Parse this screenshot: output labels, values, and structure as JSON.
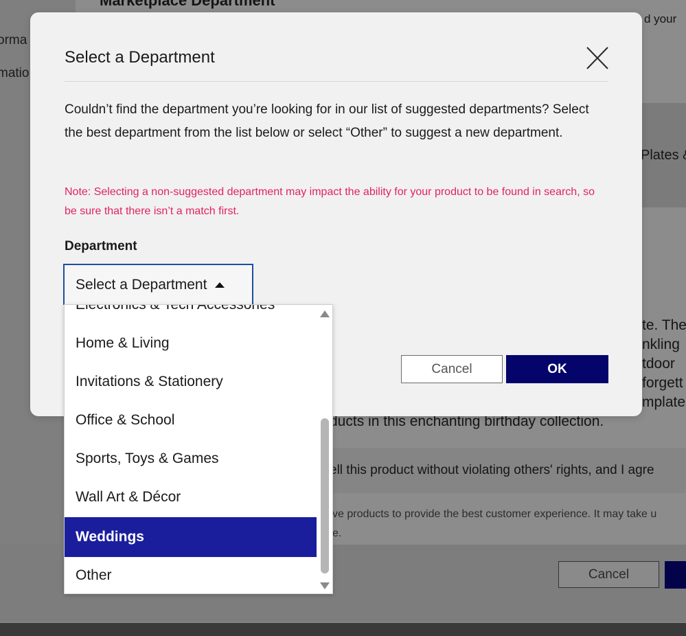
{
  "background": {
    "top_heading": "Marketplace Department",
    "top_right_text": "d your",
    "sidebar_items": [
      "orma",
      "matio"
    ],
    "band_right_text": "Plates &",
    "desc_fragments": [
      "te. The",
      "nkling",
      "tdoor",
      "forgett",
      "mplate"
    ],
    "desc_last_line": "ducts in this enchanting birthday collection.",
    "rights_line": "ell this product without violating others' rights, and I agre",
    "review_line_1": "ve products to provide the best customer experience. It may take u",
    "review_line_2": "e.",
    "cancel_label": "Cancel"
  },
  "modal": {
    "title": "Select a Department",
    "description": "Couldn’t find the department you’re looking for in our list of suggested departments? Select the best department from the list below or select “Other” to suggest a new department.",
    "note": "Note: Selecting a non-suggested department may impact the ability for your product to be found in search, so be sure that there isn’t a match first.",
    "field_label": "Department",
    "select_value": "Select a Department",
    "cancel_label": "Cancel",
    "ok_label": "OK"
  },
  "dropdown": {
    "options": [
      "Electronics & Tech Accessories",
      "Home & Living",
      "Invitations & Stationery",
      "Office & School",
      "Sports, Toys & Games",
      "Wall Art & Décor",
      "Weddings",
      "Other"
    ],
    "selected": "Weddings"
  },
  "colors": {
    "note_text": "#e0245e",
    "ok_button": "#04046b",
    "selected_option": "#1a1e9c",
    "select_border": "#1b4f9c"
  },
  "icons": {
    "close": "close-icon",
    "select_caret": "caret-up-icon",
    "scroll_up": "scroll-up-icon",
    "scroll_down": "scroll-down-icon"
  }
}
